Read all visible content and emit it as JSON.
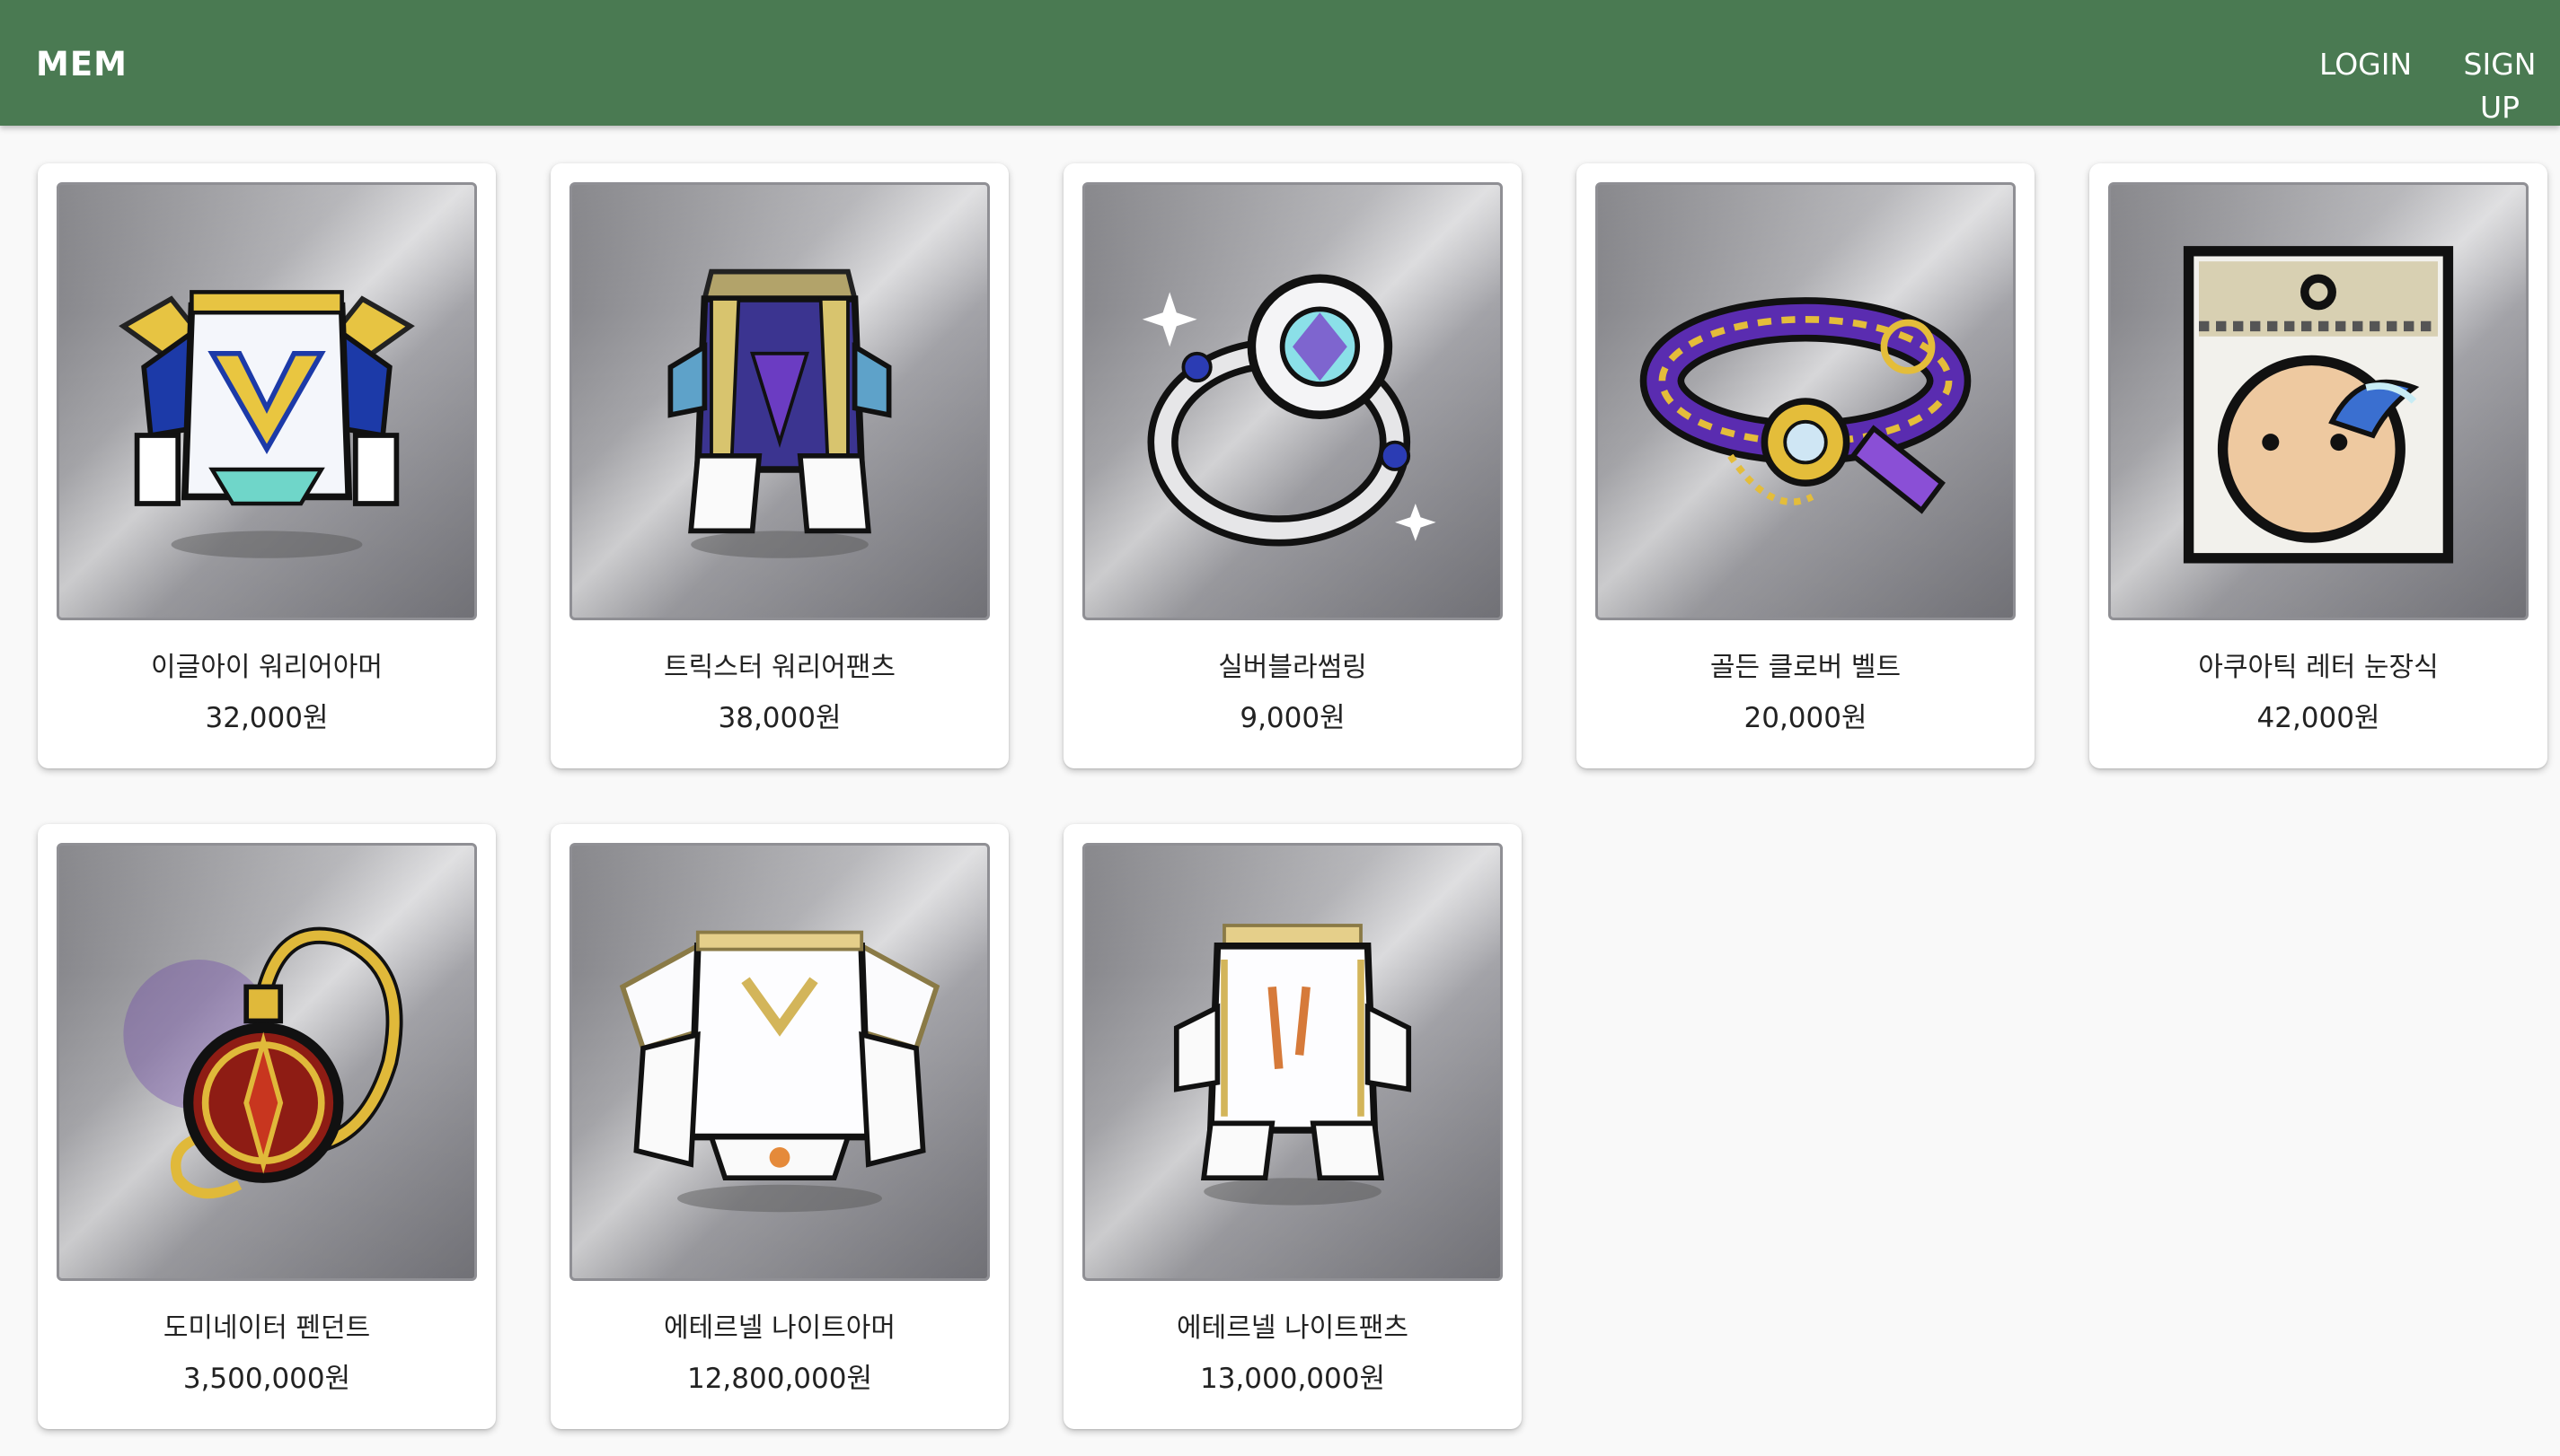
{
  "app": {
    "brand": "MEM"
  },
  "nav": {
    "login": "LOGIN",
    "signup": "SIGN UP"
  },
  "products": [
    {
      "name": "이글아이 워리어아머",
      "price": "32,000원",
      "icon": "armor-icon"
    },
    {
      "name": "트릭스터 워리어팬츠",
      "price": "38,000원",
      "icon": "pants-icon"
    },
    {
      "name": "실버블라썸링",
      "price": "9,000원",
      "icon": "ring-icon"
    },
    {
      "name": "골든 클로버 벨트",
      "price": "20,000원",
      "icon": "belt-icon"
    },
    {
      "name": "아쿠아틱 레터 눈장식",
      "price": "42,000원",
      "icon": "eye-accessory-icon"
    },
    {
      "name": "도미네이터 펜던트",
      "price": "3,500,000원",
      "icon": "pendant-icon"
    },
    {
      "name": "에테르넬 나이트아머",
      "price": "12,800,000원",
      "icon": "armor-icon"
    },
    {
      "name": "에테르넬 나이트팬츠",
      "price": "13,000,000원",
      "icon": "pants-icon"
    }
  ],
  "colors": {
    "appbar": "#4a7a52",
    "background": "#f9f9f9",
    "card": "#ffffff"
  }
}
